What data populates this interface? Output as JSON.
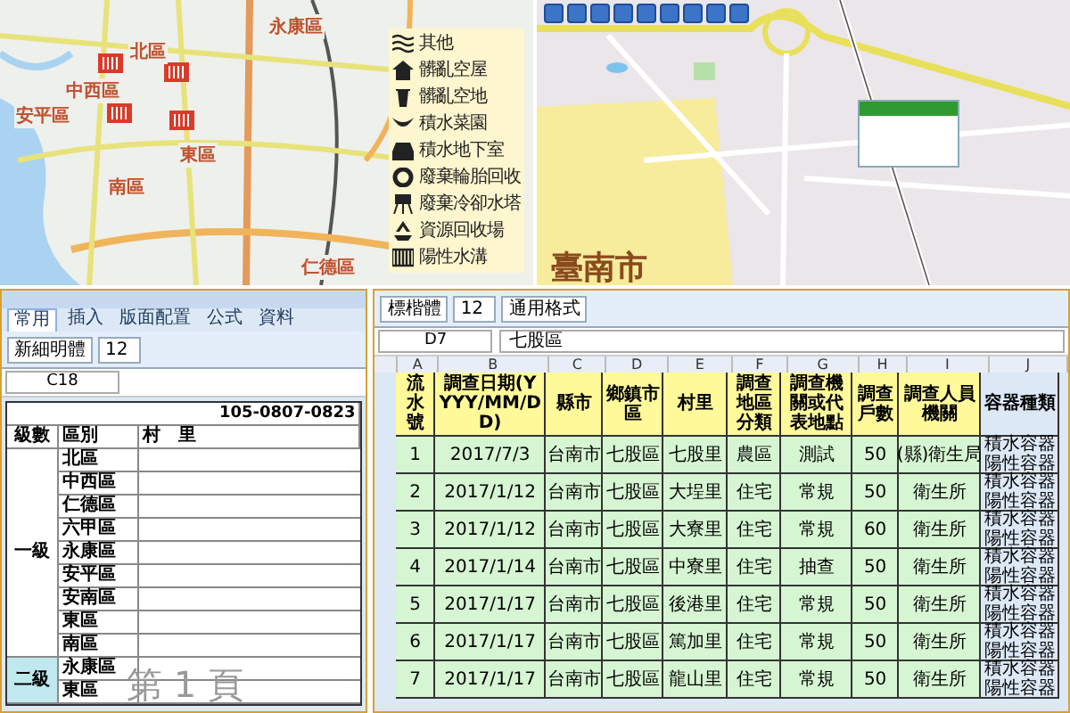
{
  "district_map": {
    "districts": [
      {
        "name": "永康區"
      },
      {
        "name": "北區"
      },
      {
        "name": "中西區"
      },
      {
        "name": "安平區"
      },
      {
        "name": "東區"
      },
      {
        "name": "南區"
      },
      {
        "name": "仁德區"
      }
    ],
    "legend": [
      {
        "kind": "other",
        "label": "其他"
      },
      {
        "kind": "house",
        "label": "髒亂空屋"
      },
      {
        "kind": "bin",
        "label": "髒亂空地"
      },
      {
        "kind": "leaf",
        "label": "積水菜園"
      },
      {
        "kind": "basement",
        "label": "積水地下室"
      },
      {
        "kind": "tire",
        "label": "廢棄輪胎回收"
      },
      {
        "kind": "tower",
        "label": "廢棄冷卻水塔"
      },
      {
        "kind": "recycle",
        "label": "資源回收場"
      },
      {
        "kind": "drain",
        "label": "陽性水溝"
      }
    ]
  },
  "street_map": {
    "city": "臺南市"
  },
  "district_sheet": {
    "tabs": [
      {
        "label": "常用",
        "selected": true
      },
      {
        "label": "插入",
        "selected": false
      },
      {
        "label": "版面配置",
        "selected": false
      },
      {
        "label": "公式",
        "selected": false
      },
      {
        "label": "資料",
        "selected": false
      }
    ],
    "font": "新細明體",
    "size": "12",
    "cell_ref": "C18",
    "title": "105-0807-0823",
    "headers": [
      "級數",
      "區別",
      "村　里"
    ],
    "groups": [
      {
        "level": "一級",
        "districts": [
          "北區",
          "中西區",
          "仁德區",
          "六甲區",
          "永康區",
          "安平區",
          "安南區",
          "東區",
          "南區"
        ]
      },
      {
        "level": "二級",
        "districts": [
          "永康區",
          "東區"
        ]
      }
    ],
    "page_label": "第 1 頁"
  },
  "survey_sheet": {
    "font": "標楷體",
    "size": "12",
    "number_format": "通用格式",
    "cell_ref": "D7",
    "formula": "七股區",
    "columns": [
      "A",
      "B",
      "C",
      "D",
      "E",
      "F",
      "G",
      "H",
      "I",
      "J"
    ],
    "headers": [
      "流水號",
      "調查日期(YYYY/MM/DD)",
      "縣市",
      "鄉鎮市區",
      "村里",
      "調查地區分類",
      "調查機關或代表地點",
      "調查戶數",
      "調查人員機關",
      "容器種類"
    ],
    "rows": [
      {
        "cells": [
          "1",
          "2017/7/3",
          "台南市",
          "七股區",
          "七股里",
          "農區",
          "測試",
          "50",
          "(縣)衛生局"
        ]
      },
      {
        "cells": [
          "2",
          "2017/1/12",
          "台南市",
          "七股區",
          "大埕里",
          "住宅",
          "常規",
          "50",
          "衛生所"
        ]
      },
      {
        "cells": [
          "3",
          "2017/1/12",
          "台南市",
          "七股區",
          "大寮里",
          "住宅",
          "常規",
          "60",
          "衛生所"
        ]
      },
      {
        "cells": [
          "4",
          "2017/1/14",
          "台南市",
          "七股區",
          "中寮里",
          "住宅",
          "抽查",
          "50",
          "衛生所"
        ]
      },
      {
        "cells": [
          "5",
          "2017/1/17",
          "台南市",
          "七股區",
          "後港里",
          "住宅",
          "常規",
          "50",
          "衛生所"
        ]
      },
      {
        "cells": [
          "6",
          "2017/1/17",
          "台南市",
          "七股區",
          "篤加里",
          "住宅",
          "常規",
          "50",
          "衛生所"
        ]
      },
      {
        "cells": [
          "7",
          "2017/1/17",
          "台南市",
          "七股區",
          "龍山里",
          "住宅",
          "常規",
          "50",
          "衛生所"
        ]
      }
    ],
    "container_types": [
      [
        "積水容器",
        "陽性容器"
      ],
      [
        "積水容器",
        "陽性容器"
      ],
      [
        "積水容器",
        "陽性容器"
      ],
      [
        "積水容器",
        "陽性容器"
      ],
      [
        "積水容器",
        "陽性容器"
      ],
      [
        "積水容器",
        "陽性容器"
      ],
      [
        "積水容器",
        "陽性容器"
      ]
    ]
  }
}
